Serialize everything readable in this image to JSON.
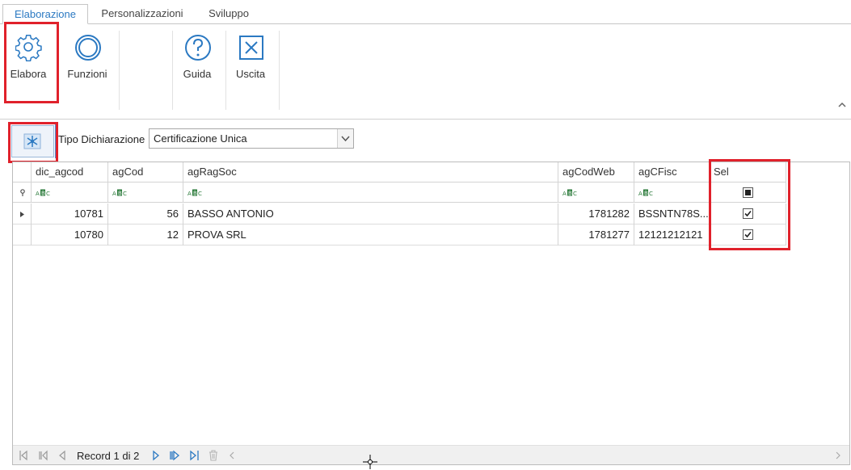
{
  "tabs": [
    {
      "label": "Elaborazione",
      "active": true
    },
    {
      "label": "Personalizzazioni",
      "active": false
    },
    {
      "label": "Sviluppo",
      "active": false
    }
  ],
  "ribbon": {
    "buttons": [
      {
        "label": "Elabora",
        "icon": "gear-icon"
      },
      {
        "label": "Funzioni",
        "icon": "circle-icon"
      },
      {
        "label": "Guida",
        "icon": "help-icon"
      },
      {
        "label": "Uscita",
        "icon": "close-box-icon"
      }
    ]
  },
  "filter": {
    "label": "Tipo Dichiarazione",
    "value": "Certificazione Unica"
  },
  "grid": {
    "columns": [
      "dic_agcod",
      "agCod",
      "agRagSoc",
      "agCodWeb",
      "agCFisc",
      "Sel"
    ],
    "rows": [
      {
        "dic_agcod": "10781",
        "agCod": "56",
        "agRagSoc": "BASSO ANTONIO",
        "agCodWeb": "1781282",
        "agCFisc": "BSSNTN78S...",
        "sel": true
      },
      {
        "dic_agcod": "10780",
        "agCod": "12",
        "agRagSoc": "PROVA SRL",
        "agCodWeb": "1781277",
        "agCFisc": "12121212121",
        "sel": true
      }
    ]
  },
  "navigator": {
    "record_text": "Record 1 di 2"
  },
  "colors": {
    "accent": "#2b79c2",
    "highlight": "#e0212b"
  }
}
